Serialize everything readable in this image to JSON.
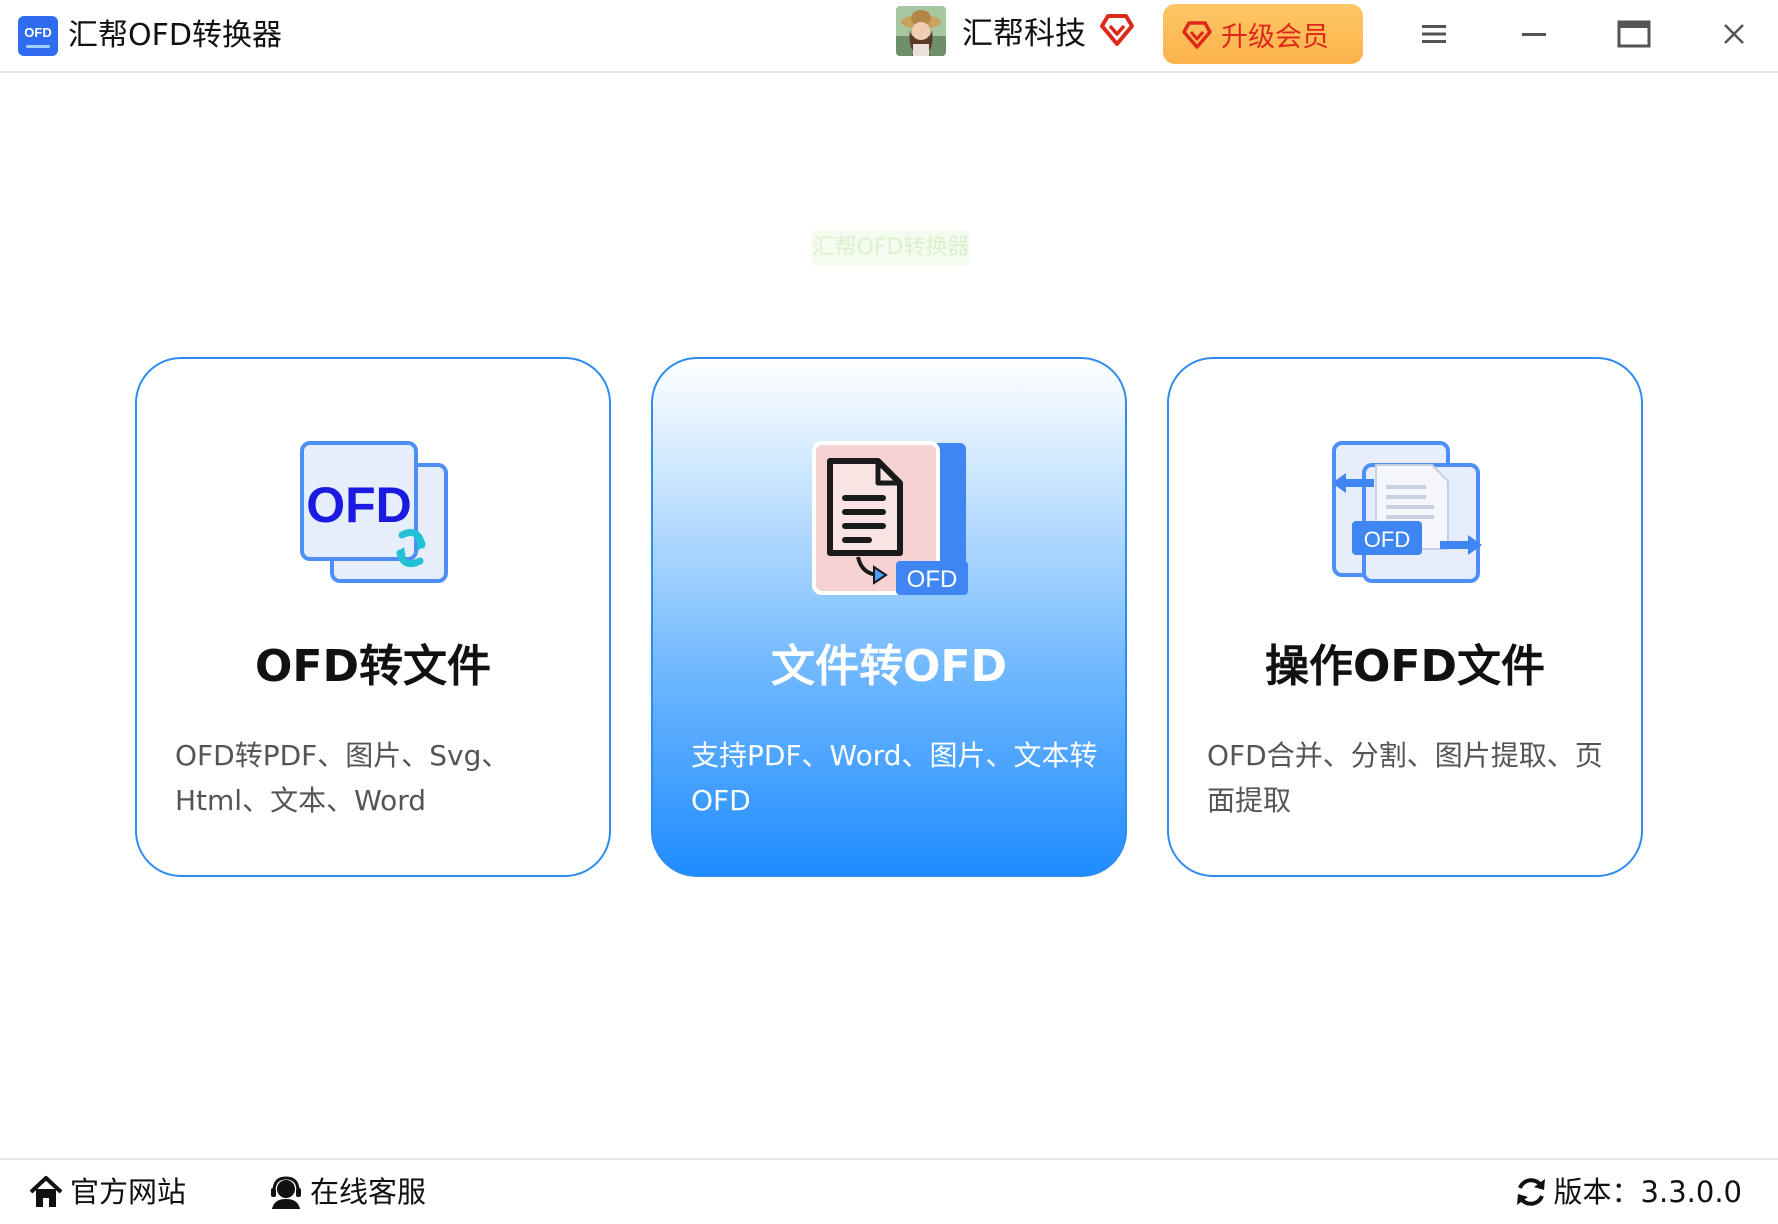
{
  "window": {
    "app_logo_text": "OFD",
    "title": "汇帮OFD转换器",
    "user_name": "汇帮科技",
    "upgrade_label": "升级会员",
    "icons": [
      "menu-icon",
      "minimize-icon",
      "maximize-icon",
      "close-icon"
    ],
    "accent_color": "#2d8cf0",
    "upgrade_color": "#fbb24a"
  },
  "watermark": "汇帮OFD转换器",
  "cards": [
    {
      "title": "OFD转文件",
      "description": "OFD转PDF、图片、Svg、Html、文本、Word",
      "icon": "ofd-convert-icon",
      "icon_text": "OFD",
      "active": false
    },
    {
      "title": "文件转OFD",
      "description": "支持PDF、Word、图片、文本转OFD",
      "icon": "file-to-ofd-icon",
      "icon_text": "OFD",
      "active": true
    },
    {
      "title": "操作OFD文件",
      "description": "OFD合并、分割、图片提取、页面提取",
      "icon": "ofd-operate-icon",
      "icon_text": "OFD",
      "active": false
    }
  ],
  "statusbar": {
    "website_label": "官方网站",
    "support_label": "在线客服",
    "version_label": "版本：3.3.0.0"
  }
}
